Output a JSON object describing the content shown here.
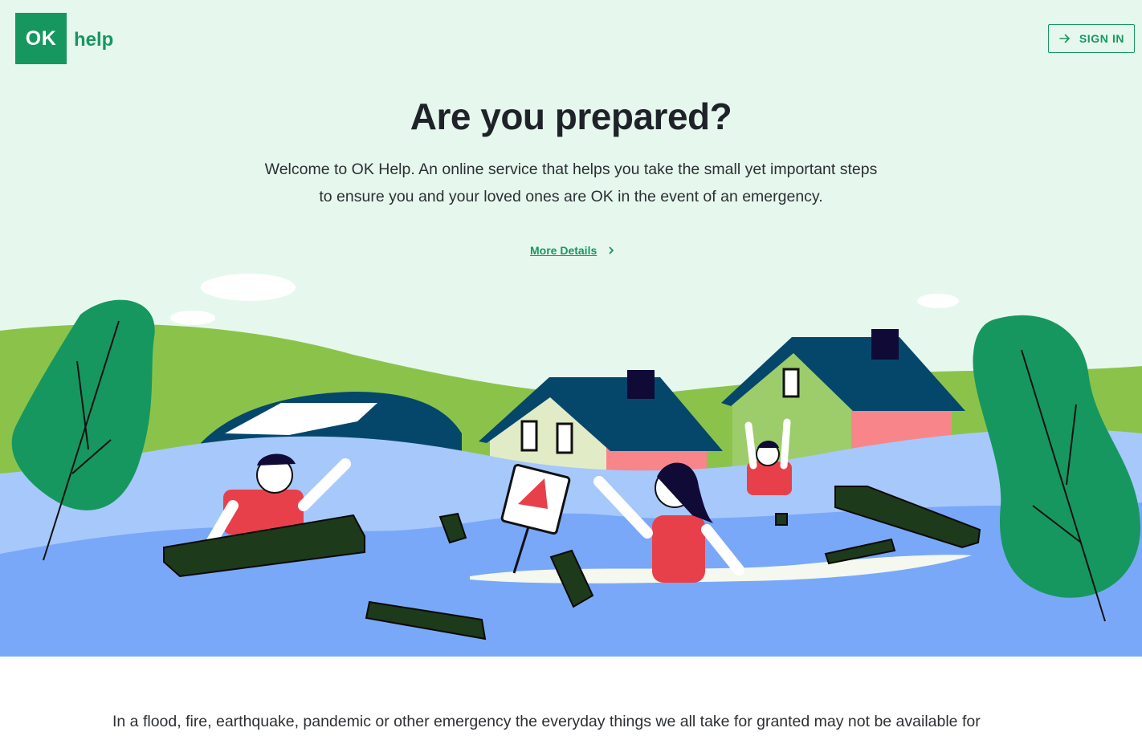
{
  "brand": {
    "mark": "OK",
    "word": "help",
    "color": "#16975f"
  },
  "header": {
    "signin_label": "SIGN IN",
    "signin_icon": "arrow-right-icon"
  },
  "hero": {
    "title": "Are you prepared?",
    "subtitle_line1": "Welcome to OK Help. An online service that helps you take the small yet important steps",
    "subtitle_line2": "to ensure you and your loved ones are OK in the event of an emergency.",
    "more_label": "More Details",
    "more_icon": "chevron-right-icon",
    "illustration": "flood-scene-illustration"
  },
  "intro": {
    "text": "In a flood, fire, earthquake, pandemic or other emergency the everyday things we all take for granted may not be available for"
  },
  "colors": {
    "background": "#e6f8ee",
    "accent": "#16975f",
    "water": "#7aa8f8",
    "grass": "#8bc34a"
  }
}
